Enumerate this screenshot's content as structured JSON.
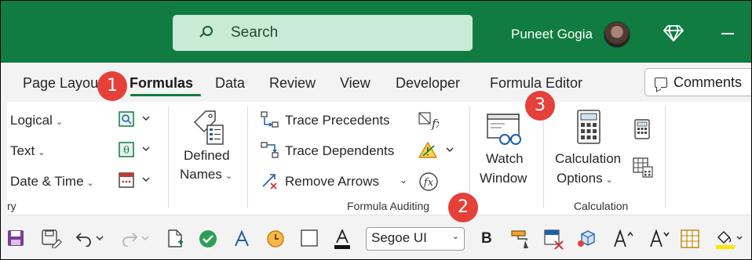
{
  "search": {
    "label": "Search"
  },
  "user": {
    "name": "Puneet Gogia"
  },
  "tabs": [
    {
      "label": "Page Layout",
      "active": false
    },
    {
      "label": "Formulas",
      "active": true
    },
    {
      "label": "Data",
      "active": false
    },
    {
      "label": "Review",
      "active": false
    },
    {
      "label": "View",
      "active": false
    },
    {
      "label": "Developer",
      "active": false
    },
    {
      "label": "Formula Editor",
      "active": false
    }
  ],
  "comments_label": "Comments",
  "ribbon": {
    "library": {
      "logical": "Logical",
      "text": "Text",
      "datetime": "Date & Time",
      "group_tail": "ry"
    },
    "defined_names": {
      "line1": "Defined",
      "line2": "Names"
    },
    "auditing": {
      "trace_precedents": "Trace Precedents",
      "trace_dependents": "Trace Dependents",
      "remove_arrows": "Remove Arrows",
      "group": "Formula Auditing"
    },
    "watch": {
      "line1": "Watch",
      "line2": "Window"
    },
    "calculation": {
      "line1": "Calculation",
      "line2": "Options",
      "group": "Calculation"
    }
  },
  "qat": {
    "font": "Segoe UI"
  },
  "badges": [
    "1",
    "2",
    "3"
  ],
  "colors": {
    "accent": "#107c41",
    "badge": "#e5403a",
    "search_bg": "#c9ead5"
  },
  "icons": [
    "search-icon",
    "diamond-icon",
    "comment-icon",
    "lookup-icon",
    "math-icon",
    "more-functions-icon",
    "defined-names-icon",
    "trace-precedents-icon",
    "trace-dependents-icon",
    "remove-arrows-icon",
    "show-formulas-icon",
    "error-checking-icon",
    "evaluate-formula-icon",
    "watch-window-icon",
    "calculator-icon",
    "calculate-now-icon",
    "calculate-sheet-icon",
    "save-icon",
    "save-as-icon",
    "undo-icon",
    "redo-icon",
    "new-file-icon",
    "check-icon",
    "format-painter-icon"
  ]
}
